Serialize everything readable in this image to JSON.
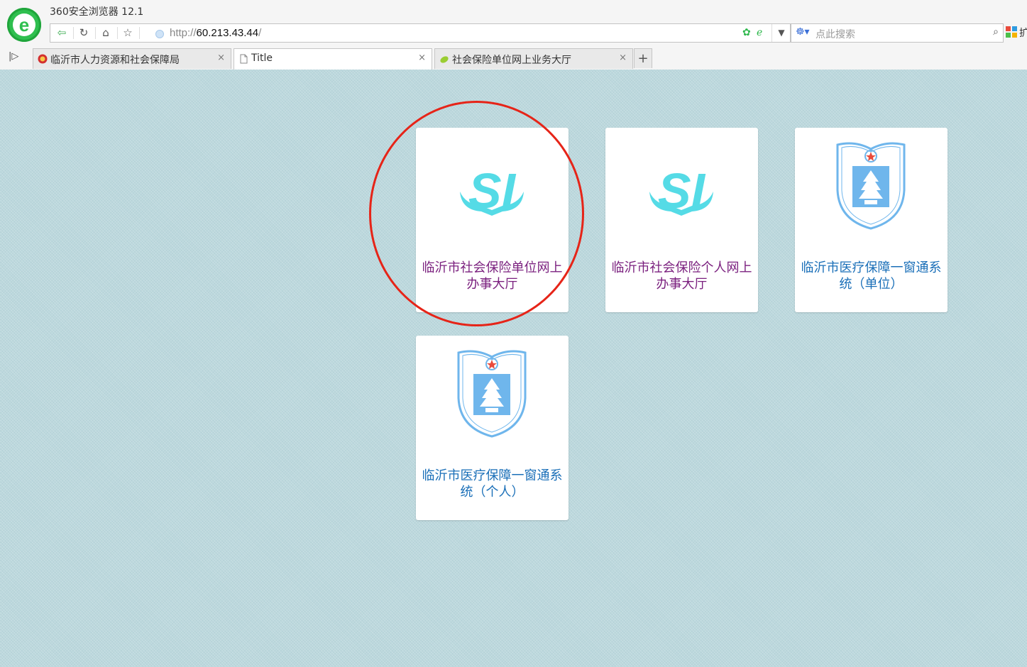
{
  "browser": {
    "app_title": "360安全浏览器 12.1",
    "url_scheme": "http://",
    "url_host": "60.213.43.44",
    "url_path": "/",
    "search_placeholder": "点此搜索",
    "ext_label": "扩",
    "tabs": [
      {
        "label": "临沂市人力资源和社会保障局",
        "active": false
      },
      {
        "label": "Title",
        "active": true
      },
      {
        "label": "社会保险单位网上业务大厅",
        "active": false
      }
    ],
    "new_tab_glyph": "+",
    "close_glyph": "×"
  },
  "cards": [
    {
      "label": "临沂市社会保险单位网上办事大厅",
      "icon": "si-logo-icon",
      "color": "#7a1f7e"
    },
    {
      "label": "临沂市社会保险个人网上办事大厅",
      "icon": "si-logo-icon",
      "color": "#7a1f7e"
    },
    {
      "label": "临沂市医疗保障一窗通系统（单位）",
      "icon": "linyi-healthcare-shield-icon",
      "color": "#1a6fb8"
    },
    {
      "label": "临沂市医疗保障一窗通系统（个人）",
      "icon": "linyi-healthcare-shield-icon",
      "color": "#1a6fb8"
    }
  ],
  "annotation": {
    "type": "red-circle",
    "target": "cards.0"
  },
  "colors": {
    "page_bg": "#bcd8dd",
    "si_logo": "#55dbe6",
    "shield": "#6fb6ec",
    "circle": "#e62418"
  }
}
